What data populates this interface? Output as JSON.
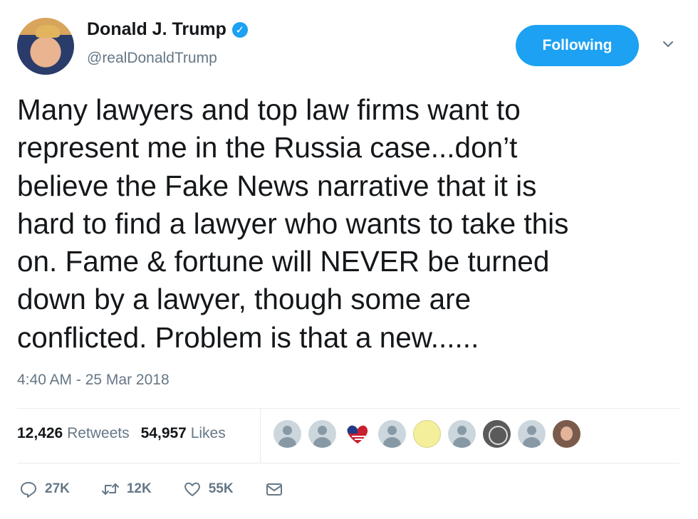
{
  "user": {
    "display_name": "Donald J. Trump",
    "handle": "@realDonaldTrump",
    "verified_icon": "verified-badge-icon"
  },
  "follow_button_label": "Following",
  "menu_icon": "chevron-down-icon",
  "tweet": {
    "lines": [
      "Many lawyers and top law firms want to",
      "represent me in the Russia case...don’t",
      "believe the Fake News narrative that it is",
      "hard to find a lawyer who wants to take this",
      "on. Fame & fortune will NEVER be turned",
      "down by a lawyer, though some are",
      "conflicted. Problem is that a new......"
    ],
    "timestamp": "4:40 AM - 25 Mar 2018"
  },
  "stats": {
    "retweets_count": "12,426",
    "retweets_label": "Retweets",
    "likes_count": "54,957",
    "likes_label": "Likes"
  },
  "actions": {
    "reply_count": "27K",
    "retweet_count": "12K",
    "like_count": "55K"
  },
  "colors": {
    "accent": "#1da1f2",
    "secondary_text": "#657786",
    "primary_text": "#14171a",
    "divider": "#e6ecf0"
  }
}
